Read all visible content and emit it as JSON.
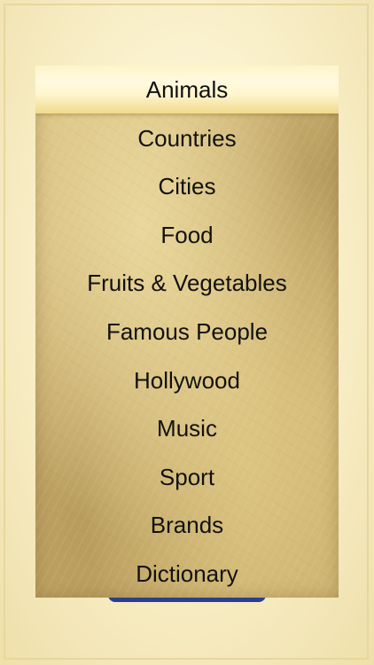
{
  "menu": {
    "items": [
      {
        "label": "Animals",
        "selected": true
      },
      {
        "label": "Countries",
        "selected": false
      },
      {
        "label": "Cities",
        "selected": false
      },
      {
        "label": "Food",
        "selected": false
      },
      {
        "label": "Fruits & Vegetables",
        "selected": false
      },
      {
        "label": "Famous People",
        "selected": false
      },
      {
        "label": "Hollywood",
        "selected": false
      },
      {
        "label": "Music",
        "selected": false
      },
      {
        "label": "Sport",
        "selected": false
      },
      {
        "label": "Brands",
        "selected": false
      },
      {
        "label": "Dictionary",
        "selected": false
      }
    ]
  },
  "colors": {
    "page_background": "#f7efc9",
    "panel_parchment": "#d3b979",
    "selected_highlight": "#fff6cf",
    "text": "#111111",
    "bottom_tab": "#2b3f8f"
  }
}
